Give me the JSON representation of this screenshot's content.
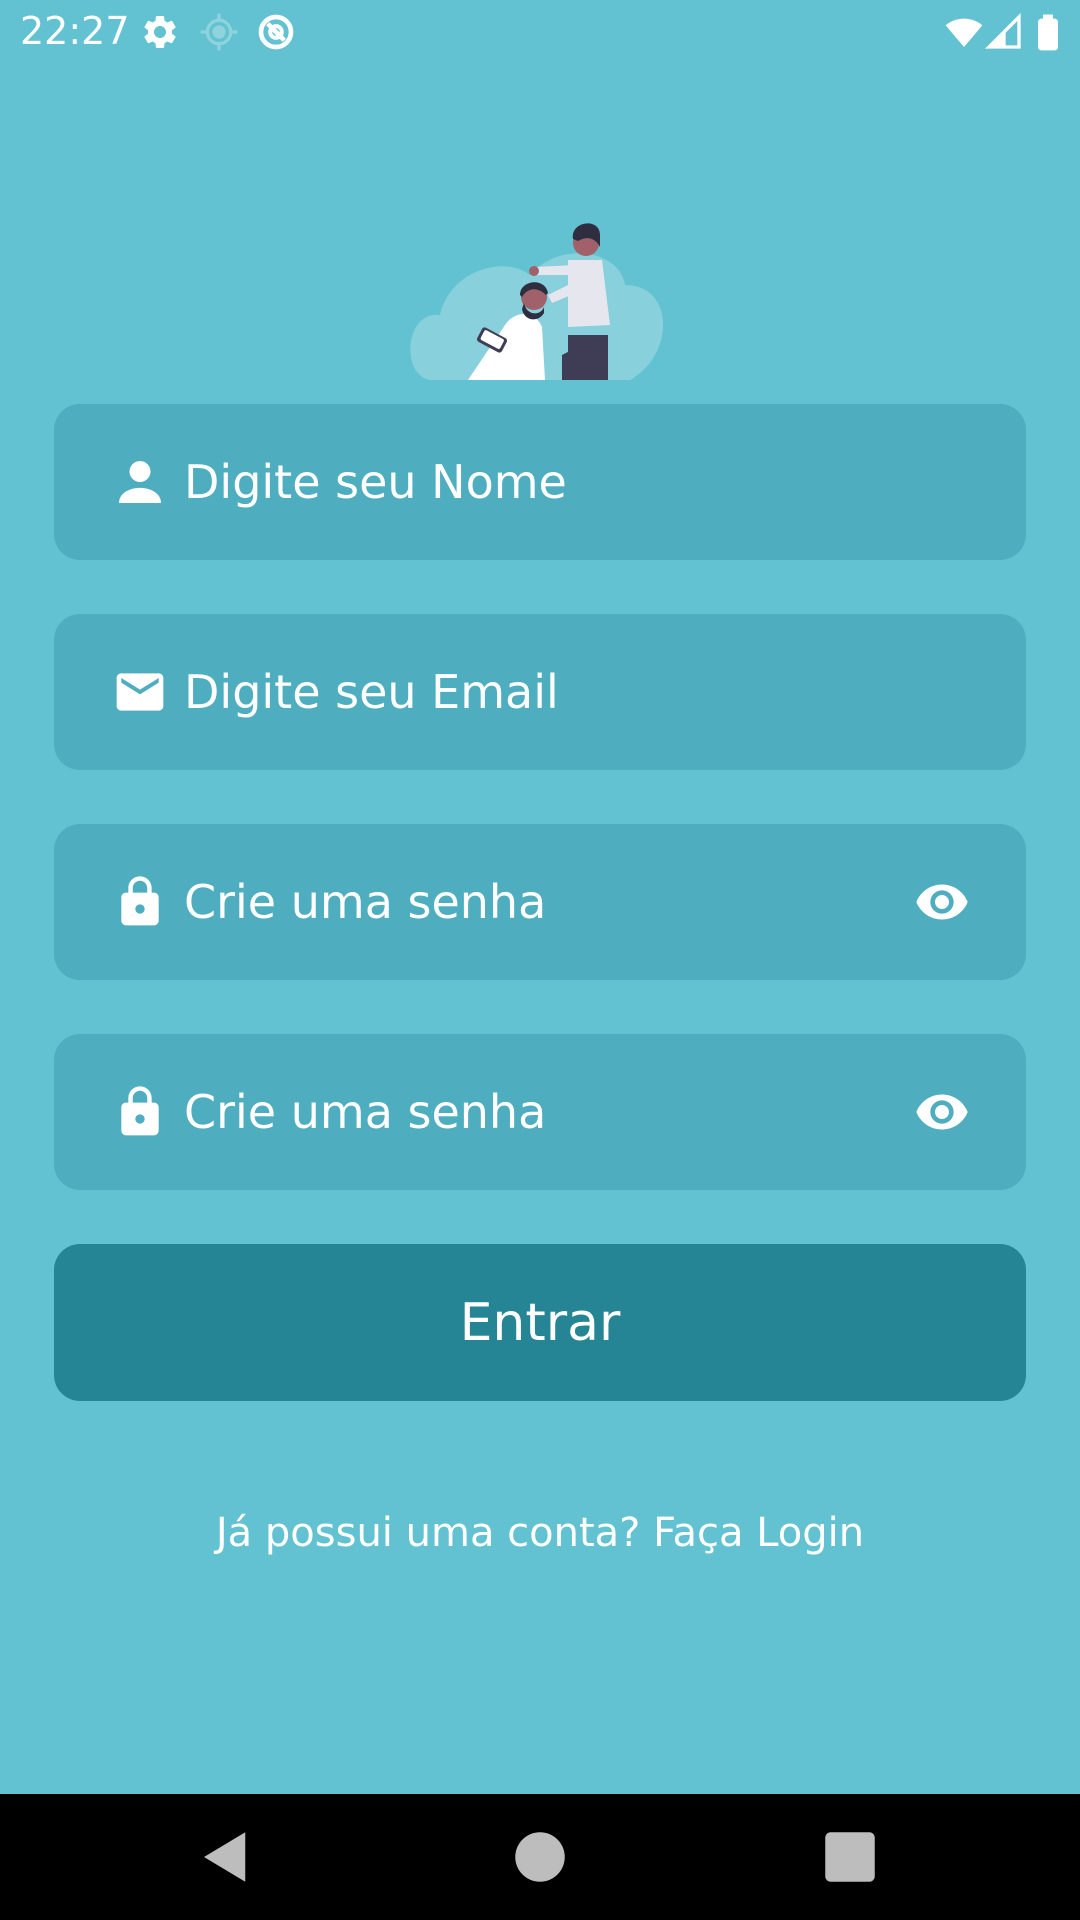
{
  "status_bar": {
    "time": "22:27",
    "icons": [
      "gear-icon",
      "location-icon",
      "app-notification-icon",
      "wifi-icon",
      "signal-icon",
      "battery-icon"
    ]
  },
  "illustration": {
    "name": "barber-illustration"
  },
  "form": {
    "name_field": {
      "placeholder": "Digite seu Nome",
      "icon": "person-icon"
    },
    "email_field": {
      "placeholder": "Digite seu Email",
      "icon": "mail-icon"
    },
    "password_field": {
      "placeholder": "Crie uma senha",
      "icon": "lock-icon",
      "toggle_icon": "eye-icon"
    },
    "confirm_password_field": {
      "placeholder": "Crie uma senha",
      "icon": "lock-icon",
      "toggle_icon": "eye-icon"
    },
    "submit_label": "Entrar",
    "login_link": "Já possui uma conta? Faça Login"
  },
  "nav_bar": {
    "icons": [
      "back-icon",
      "home-icon",
      "recents-icon"
    ]
  },
  "colors": {
    "background": "#62c2d1",
    "field": "#4eaebf",
    "button": "#258595",
    "text": "#ffffff"
  }
}
